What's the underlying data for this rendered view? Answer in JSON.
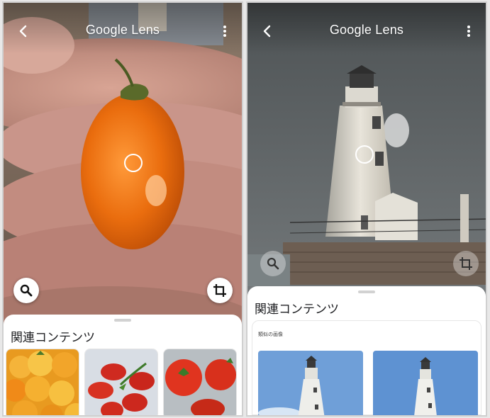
{
  "left_screen": {
    "app_title": "Google Lens",
    "related_title": "関連コンテンツ"
  },
  "right_screen": {
    "app_title": "Google Lens",
    "related_title": "関連コンテンツ",
    "similar_images_label": "類似の画像"
  },
  "icons": {
    "back": "back-arrow-icon",
    "more": "more-vert-icon",
    "search": "search-icon",
    "crop": "crop-icon",
    "focus": "focus-circle-icon"
  },
  "colors": {
    "tomato_orange": "#e8690a",
    "sky_gray": "#5f6466",
    "sheet_bg": "#ffffff"
  }
}
